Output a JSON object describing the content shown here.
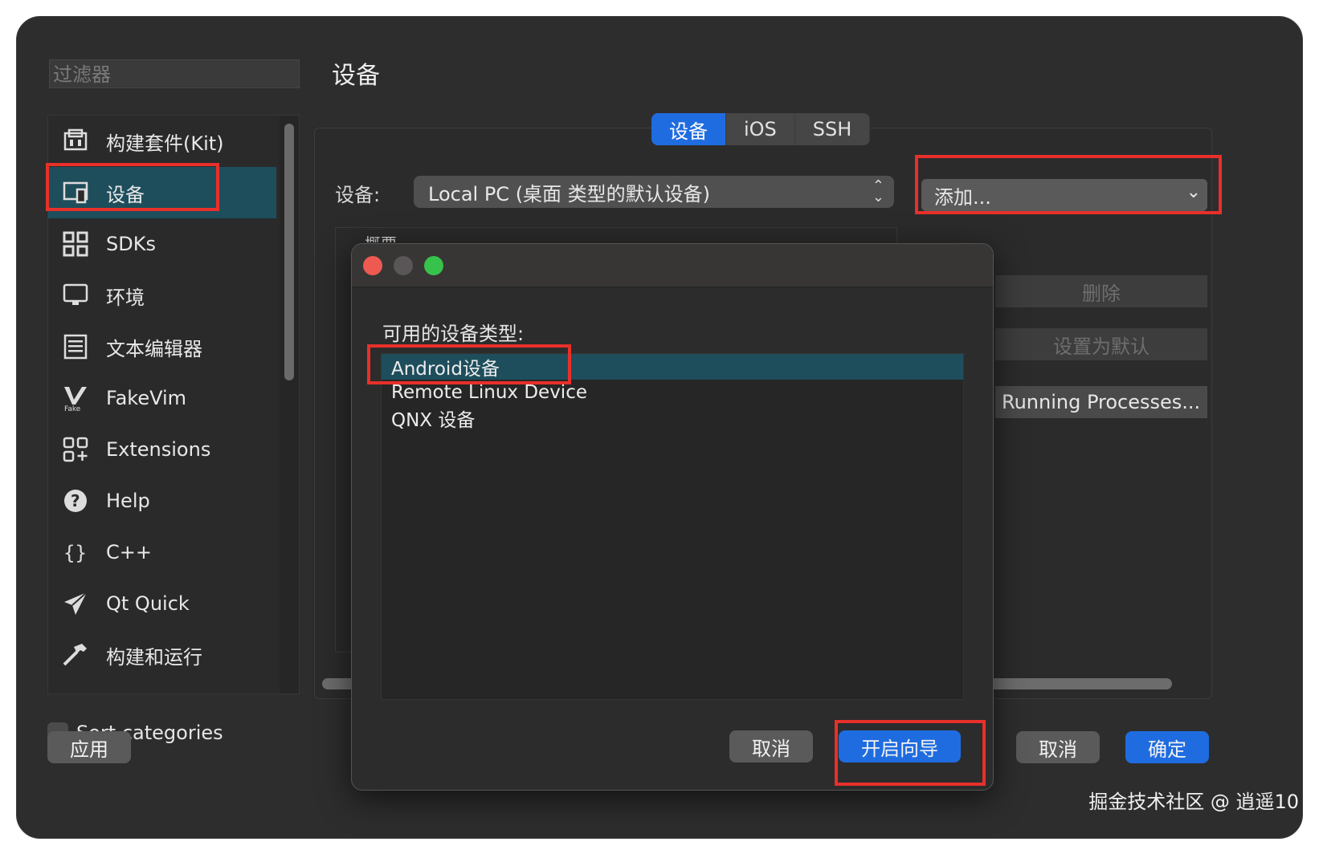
{
  "filter": {
    "placeholder": "过滤器"
  },
  "sidebar": {
    "items": [
      {
        "label": "构建套件(Kit)",
        "icon": "kit-icon"
      },
      {
        "label": "设备",
        "icon": "device-icon",
        "selected": true
      },
      {
        "label": "SDKs",
        "icon": "sdks-grid-icon"
      },
      {
        "label": "环境",
        "icon": "monitor-icon"
      },
      {
        "label": "文本编辑器",
        "icon": "text-editor-icon"
      },
      {
        "label": "FakeVim",
        "icon": "fakevim-icon"
      },
      {
        "label": "Extensions",
        "icon": "extensions-icon"
      },
      {
        "label": "Help",
        "icon": "help-icon"
      },
      {
        "label": "C++",
        "icon": "braces-icon"
      },
      {
        "label": "Qt Quick",
        "icon": "paper-plane-icon"
      },
      {
        "label": "构建和运行",
        "icon": "hammer-icon"
      }
    ]
  },
  "sort_categories": "Sort categories",
  "apply_label": "应用",
  "page_title": "设备",
  "tabs": [
    "设备",
    "iOS",
    "SSH"
  ],
  "device": {
    "label": "设备:",
    "selected": "Local PC (桌面 类型的默认设备)"
  },
  "add_select": "添加...",
  "overview_title": "概要",
  "side_buttons": {
    "delete": "删除",
    "set_default": "设置为默认",
    "running_processes": "Running Processes..."
  },
  "dialog": {
    "label": "可用的设备类型:",
    "types": [
      "Android设备",
      "Remote Linux Device",
      "QNX 设备"
    ],
    "cancel": "取消",
    "start_wizard": "开启向导"
  },
  "footer": {
    "cancel": "取消",
    "ok": "确定"
  },
  "watermark": "掘金技术社区 @ 逍遥10",
  "colors": {
    "accent": "#1f6ce0",
    "selection": "#1e4e5c",
    "highlight_box": "#e8302a"
  }
}
